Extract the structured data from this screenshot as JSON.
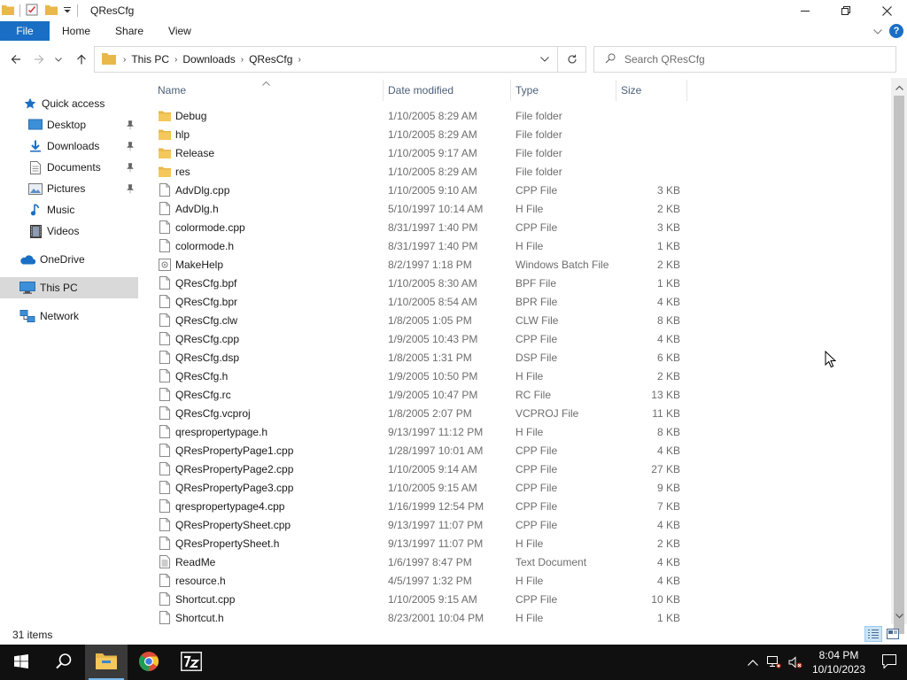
{
  "window": {
    "title": "QResCfg",
    "tabs": [
      "File",
      "Home",
      "Share",
      "View"
    ]
  },
  "address": {
    "crumbs": [
      "This PC",
      "Downloads",
      "QResCfg"
    ]
  },
  "search": {
    "placeholder": "Search QResCfg"
  },
  "sidebar": {
    "quick_access": "Quick access",
    "items": [
      "Desktop",
      "Downloads",
      "Documents",
      "Pictures",
      "Music",
      "Videos"
    ],
    "onedrive": "OneDrive",
    "this_pc": "This PC",
    "network": "Network"
  },
  "columns": {
    "name": "Name",
    "date": "Date modified",
    "type": "Type",
    "size": "Size"
  },
  "files": [
    {
      "name": "Debug",
      "date": "1/10/2005 8:29 AM",
      "type": "File folder",
      "size": "",
      "icon": "folder-icon"
    },
    {
      "name": "hlp",
      "date": "1/10/2005 8:29 AM",
      "type": "File folder",
      "size": "",
      "icon": "folder-icon"
    },
    {
      "name": "Release",
      "date": "1/10/2005 9:17 AM",
      "type": "File folder",
      "size": "",
      "icon": "folder-icon"
    },
    {
      "name": "res",
      "date": "1/10/2005 8:29 AM",
      "type": "File folder",
      "size": "",
      "icon": "folder-icon"
    },
    {
      "name": "AdvDlg.cpp",
      "date": "1/10/2005 9:10 AM",
      "type": "CPP File",
      "size": "3 KB",
      "icon": "file-icon"
    },
    {
      "name": "AdvDlg.h",
      "date": "5/10/1997 10:14 AM",
      "type": "H File",
      "size": "2 KB",
      "icon": "file-icon"
    },
    {
      "name": "colormode.cpp",
      "date": "8/31/1997 1:40 PM",
      "type": "CPP File",
      "size": "3 KB",
      "icon": "file-icon"
    },
    {
      "name": "colormode.h",
      "date": "8/31/1997 1:40 PM",
      "type": "H File",
      "size": "1 KB",
      "icon": "file-icon"
    },
    {
      "name": "MakeHelp",
      "date": "8/2/1997 1:18 PM",
      "type": "Windows Batch File",
      "size": "2 KB",
      "icon": "batch-file-icon"
    },
    {
      "name": "QResCfg.bpf",
      "date": "1/10/2005 8:30 AM",
      "type": "BPF File",
      "size": "1 KB",
      "icon": "file-icon"
    },
    {
      "name": "QResCfg.bpr",
      "date": "1/10/2005 8:54 AM",
      "type": "BPR File",
      "size": "4 KB",
      "icon": "file-icon"
    },
    {
      "name": "QResCfg.clw",
      "date": "1/8/2005 1:05 PM",
      "type": "CLW File",
      "size": "8 KB",
      "icon": "file-icon"
    },
    {
      "name": "QResCfg.cpp",
      "date": "1/9/2005 10:43 PM",
      "type": "CPP File",
      "size": "4 KB",
      "icon": "file-icon"
    },
    {
      "name": "QResCfg.dsp",
      "date": "1/8/2005 1:31 PM",
      "type": "DSP File",
      "size": "6 KB",
      "icon": "file-icon"
    },
    {
      "name": "QResCfg.h",
      "date": "1/9/2005 10:50 PM",
      "type": "H File",
      "size": "2 KB",
      "icon": "file-icon"
    },
    {
      "name": "QResCfg.rc",
      "date": "1/9/2005 10:47 PM",
      "type": "RC File",
      "size": "13 KB",
      "icon": "file-icon"
    },
    {
      "name": "QResCfg.vcproj",
      "date": "1/8/2005 2:07 PM",
      "type": "VCPROJ File",
      "size": "11 KB",
      "icon": "file-icon"
    },
    {
      "name": "qrespropertypage.h",
      "date": "9/13/1997 11:12 PM",
      "type": "H File",
      "size": "8 KB",
      "icon": "file-icon"
    },
    {
      "name": "QResPropertyPage1.cpp",
      "date": "1/28/1997 10:01 AM",
      "type": "CPP File",
      "size": "4 KB",
      "icon": "file-icon"
    },
    {
      "name": "QResPropertyPage2.cpp",
      "date": "1/10/2005 9:14 AM",
      "type": "CPP File",
      "size": "27 KB",
      "icon": "file-icon"
    },
    {
      "name": "QResPropertyPage3.cpp",
      "date": "1/10/2005 9:15 AM",
      "type": "CPP File",
      "size": "9 KB",
      "icon": "file-icon"
    },
    {
      "name": "qrespropertypage4.cpp",
      "date": "1/16/1999 12:54 PM",
      "type": "CPP File",
      "size": "7 KB",
      "icon": "file-icon"
    },
    {
      "name": "QResPropertySheet.cpp",
      "date": "9/13/1997 11:07 PM",
      "type": "CPP File",
      "size": "4 KB",
      "icon": "file-icon"
    },
    {
      "name": "QResPropertySheet.h",
      "date": "9/13/1997 11:07 PM",
      "type": "H File",
      "size": "2 KB",
      "icon": "file-icon"
    },
    {
      "name": "ReadMe",
      "date": "1/6/1997 8:47 PM",
      "type": "Text Document",
      "size": "4 KB",
      "icon": "text-file-icon"
    },
    {
      "name": "resource.h",
      "date": "4/5/1997 1:32 PM",
      "type": "H File",
      "size": "4 KB",
      "icon": "file-icon"
    },
    {
      "name": "Shortcut.cpp",
      "date": "1/10/2005 9:15 AM",
      "type": "CPP File",
      "size": "10 KB",
      "icon": "file-icon"
    },
    {
      "name": "Shortcut.h",
      "date": "8/23/2001 10:04 PM",
      "type": "H File",
      "size": "1 KB",
      "icon": "file-icon"
    }
  ],
  "status": {
    "count": "31 items"
  },
  "taskbar": {
    "time": "8:04 PM",
    "date": "10/10/2023"
  },
  "colors": {
    "accent": "#1a6fc4",
    "folder": "#e8b84a",
    "header_text": "#4c607a",
    "taskbar": "#101010"
  }
}
